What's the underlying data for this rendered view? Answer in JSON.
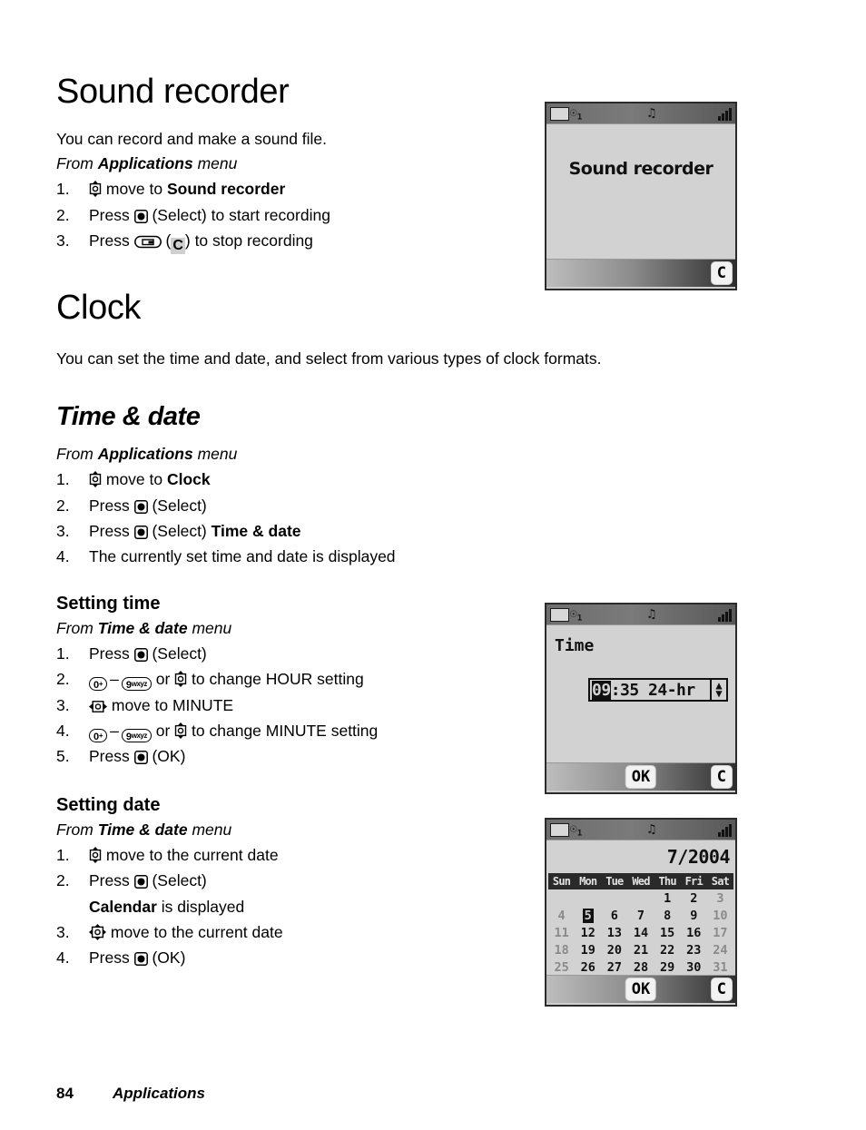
{
  "page": {
    "number": "84",
    "section": "Applications"
  },
  "sections": [
    {
      "id": "sound-recorder",
      "heading": "Sound recorder",
      "intro": "You can record and make a sound file.",
      "from": {
        "prefix": "From ",
        "menu": "Applications",
        "suffix": " menu"
      },
      "steps": [
        {
          "num": "1.",
          "icon": "nav-updown-icon",
          "pre": "",
          "mid": " move to ",
          "bold": "Sound recorder",
          "post": ""
        },
        {
          "num": "2.",
          "icon": "select-key-icon",
          "pre": "Press ",
          "mid": " (Select) to start recording",
          "bold": "",
          "post": ""
        },
        {
          "num": "3.",
          "icon": "softkey-icon",
          "pre": "Press ",
          "mid": " (",
          "clear": "C",
          "post": ") to stop recording"
        }
      ]
    },
    {
      "id": "clock",
      "heading": "Clock",
      "intro": "You can set the time and date, and select from various types of clock formats."
    }
  ],
  "time_and_date": {
    "heading": "Time & date",
    "from": {
      "prefix": "From ",
      "menu": "Applications",
      "suffix": " menu"
    },
    "steps": [
      {
        "num": "1.",
        "icon": "nav-updown-icon",
        "pre": "",
        "mid": " move to ",
        "bold": "Clock",
        "post": ""
      },
      {
        "num": "2.",
        "icon": "select-key-icon",
        "pre": "Press ",
        "mid": " (Select)",
        "bold": "",
        "post": ""
      },
      {
        "num": "3.",
        "icon": "select-key-icon",
        "pre": "Press ",
        "mid": " (Select) ",
        "bold": "Time & date",
        "post": ""
      },
      {
        "num": "4.",
        "icon": "",
        "pre": "The currently set time and date is displayed",
        "mid": "",
        "bold": "",
        "post": ""
      }
    ]
  },
  "setting_time": {
    "heading": "Setting time",
    "from": {
      "prefix": "From ",
      "menu": "Time & date",
      "suffix": " menu"
    },
    "steps": [
      {
        "num": "1.",
        "text_before": "Press ",
        "icon": "select-key-icon",
        "text_after": " (Select)"
      },
      {
        "num": "2.",
        "key_low": "0",
        "key_low_sup": "+",
        "key_high": "9",
        "key_high_sup": "wxyz",
        "conj": " or ",
        "icon": "nav-updown-icon",
        "text_after": " to change HOUR setting"
      },
      {
        "num": "3.",
        "icon": "nav-leftright-icon",
        "text_after": " move to MINUTE"
      },
      {
        "num": "4.",
        "key_low": "0",
        "key_low_sup": "+",
        "key_high": "9",
        "key_high_sup": "wxyz",
        "conj": " or ",
        "icon": "nav-updown-icon",
        "text_after": " to change MINUTE setting"
      },
      {
        "num": "5.",
        "text_before": "Press ",
        "icon": "select-key-icon",
        "text_after": " (OK)"
      }
    ],
    "dash": "–"
  },
  "setting_date": {
    "heading": "Setting date",
    "from": {
      "prefix": "From ",
      "menu": "Time & date",
      "suffix": " menu"
    },
    "steps": [
      {
        "num": "1.",
        "icon": "nav-updown-icon",
        "text_after": " move to the current date"
      },
      {
        "num": "2.",
        "text_before": "Press ",
        "icon": "select-key-icon",
        "text_after": " (Select)"
      },
      {
        "num": "",
        "bold": "Calendar",
        "text_after": " is displayed"
      },
      {
        "num": "3.",
        "icon": "nav-4way-icon",
        "text_after": " move to the current date"
      },
      {
        "num": "4.",
        "text_before": "Press ",
        "icon": "select-key-icon",
        "text_after": " (OK)"
      }
    ]
  },
  "screens": {
    "sound_recorder": {
      "title": "Sound recorder",
      "statusbar": {
        "battery": "battery-icon",
        "network": "network-1-icon",
        "sound": "sound-profile-icon",
        "signal": "signal-bars-icon"
      },
      "softkeys": {
        "center": "",
        "right": "C"
      }
    },
    "time": {
      "label": "Time",
      "hour": "09",
      "rest": ":35 24-hr",
      "spinner_up": "▲",
      "spinner_down": "▼",
      "softkeys": {
        "center": "OK",
        "right": "C"
      }
    },
    "calendar": {
      "monthyear": "7/2004",
      "weekdays": [
        "Sun",
        "Mon",
        "Tue",
        "Wed",
        "Thu",
        "Fri",
        "Sat"
      ],
      "weeks": [
        [
          "",
          "",
          "",
          "",
          "1",
          "2",
          "3"
        ],
        [
          "4",
          "5",
          "6",
          "7",
          "8",
          "9",
          "10"
        ],
        [
          "11",
          "12",
          "13",
          "14",
          "15",
          "16",
          "17"
        ],
        [
          "18",
          "19",
          "20",
          "21",
          "22",
          "23",
          "24"
        ],
        [
          "25",
          "26",
          "27",
          "28",
          "29",
          "30",
          "31"
        ]
      ],
      "selected": "5",
      "softkeys": {
        "center": "OK",
        "right": "C"
      }
    }
  }
}
